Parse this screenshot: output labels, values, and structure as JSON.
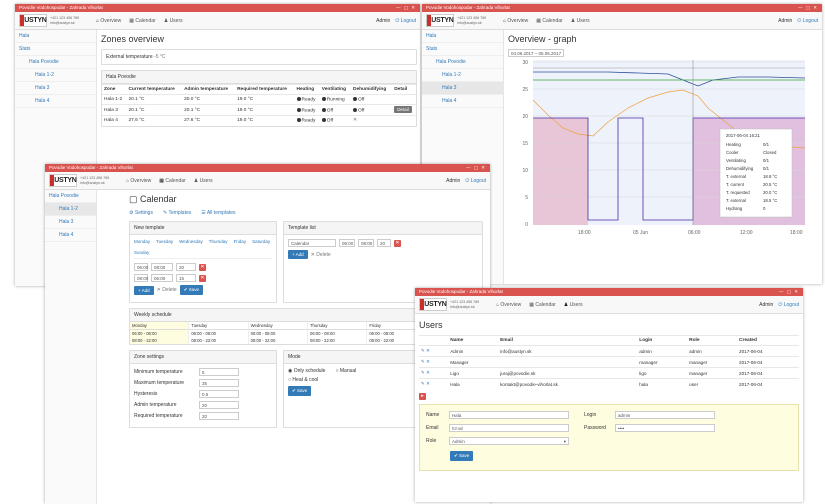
{
  "brand": {
    "logo_text": "AUSTYN",
    "contact_line1": "+421 123 456 789",
    "contact_line2": "info@austyn.sk"
  },
  "nav": {
    "overview": "Overview",
    "calendar": "Calendar",
    "users": "Users",
    "admin": "Admin",
    "logout": "Logout"
  },
  "win1": {
    "title": "Povodie Vodohospodar - Zahrada Vihorlat",
    "sidebar": [
      "Hala",
      "Stats",
      "Hala Povodie",
      "Hala 1-2",
      "Hala 3",
      "Hala 4"
    ],
    "heading": "Zones overview",
    "ext_temp_label": "External temperature",
    "ext_temp_value": "-5",
    "panel_title": "Hala Povodie",
    "columns": [
      "Zone",
      "Current temperature",
      "Admin temperature",
      "Required temperature",
      "Heating",
      "Ventilating",
      "Dehumidifying",
      "Detail"
    ],
    "rows": [
      [
        "Hala 1-2",
        "20.1 °C",
        "20.0 °C",
        "19.0 °C",
        "Ready",
        "Running",
        "Off",
        ""
      ],
      [
        "Hala 3",
        "20.1 °C",
        "20.1 °C",
        "19.0 °C",
        "Ready",
        "Off",
        "Off",
        "Detail"
      ],
      [
        "Hala 4",
        "27.6 °C",
        "27.6 °C",
        "19.0 °C",
        "Ready",
        "Off",
        "",
        ""
      ]
    ]
  },
  "win2": {
    "title": "Povodie Vodohospodar - Zahrada Vihorlat",
    "sidebar": [
      "Hala",
      "Stats",
      "Hala Povodie",
      "Hala 1-2",
      "Hala 3",
      "Hala 4"
    ],
    "heading": "Overview - graph",
    "date_from": "04.06.2017",
    "date_to": "05.06.2017",
    "x_ticks": [
      "18:00",
      "05 Jun",
      "06:00",
      "12:00",
      "18:00"
    ],
    "y_ticks": [
      "30",
      "25",
      "20",
      "15",
      "10",
      "5",
      "0"
    ],
    "tooltip": [
      [
        "2017-06-04 16:21",
        ""
      ],
      [
        "Heating",
        "0/1"
      ],
      [
        "Cooler",
        "Closed"
      ],
      [
        "Ventilating",
        "0/1"
      ],
      [
        "Dehumidifying",
        "0/1"
      ],
      [
        "T. external",
        "18.8 °C"
      ],
      [
        "T. current",
        "20.5 °C"
      ],
      [
        "T. requested",
        "20.0 °C"
      ],
      [
        "T. external",
        "18.5 °C"
      ],
      [
        "Hydrang",
        "0"
      ]
    ]
  },
  "win3": {
    "title": "Povodie Vodohospodar - Zahrada Vihorlat",
    "sidebar": [
      "Hala Povodie",
      "Hala 1-2",
      "Hala 3",
      "Hala 4"
    ],
    "heading": "Calendar",
    "subtabs": [
      "Settings",
      "Templates",
      "All templates"
    ],
    "new_template": "New template",
    "days": [
      "Monday",
      "Tuesday",
      "Wednesday",
      "Thursday",
      "Friday",
      "Saturday",
      "Sunday"
    ],
    "time1": "06:00",
    "time2": "08:00",
    "val1": "20",
    "val2": "15",
    "add": "Add",
    "delete": "Delete",
    "save": "Save",
    "template_list": "Template list",
    "weekly_title": "Weekly schedule",
    "week_days": [
      "Monday",
      "Tuesday",
      "Wednesday",
      "Thursday",
      "Friday",
      "Saturday"
    ],
    "week_slots": [
      "06:00 - 08:00",
      "08:00 - 22:00"
    ],
    "settings_title": "Zone settings",
    "settings": [
      [
        "Minimum temperature",
        "5"
      ],
      [
        "Maximum temperature",
        "35"
      ],
      [
        "Hysteresis",
        "0.5"
      ],
      [
        "Admin temperature",
        "20"
      ],
      [
        "Required temperature",
        "20"
      ]
    ],
    "mode_title": "Mode",
    "mode_opts": [
      "Only schedule",
      "Manual",
      "Heat & cool"
    ]
  },
  "win4": {
    "title": "Povodie Vodohospodar - Zahrada Vihorlat",
    "heading": "Users",
    "columns": [
      "Name",
      "Email",
      "Login",
      "Role",
      "Created"
    ],
    "rows": [
      [
        "Admin",
        "info@austyn.sk",
        "admin",
        "admin",
        "2017-06-04"
      ],
      [
        "Manager",
        "",
        "manager",
        "manager",
        "2017-06-04"
      ],
      [
        "Ligo",
        "juraj@povodie.sk",
        "ligo",
        "manager",
        "2017-06-04"
      ],
      [
        "Hala",
        "kontakt@povodie-vihorlat.sk",
        "hala",
        "user",
        "2017-06-04"
      ]
    ],
    "form": {
      "name_label": "Name",
      "name_value": "Hala",
      "login_label": "Login",
      "login_value": "admin",
      "email_label": "Email",
      "email_ph": "Email",
      "pass_label": "Password",
      "pass_value": "••••",
      "role_label": "Role",
      "role_value": "Admin",
      "save": "Save"
    }
  }
}
